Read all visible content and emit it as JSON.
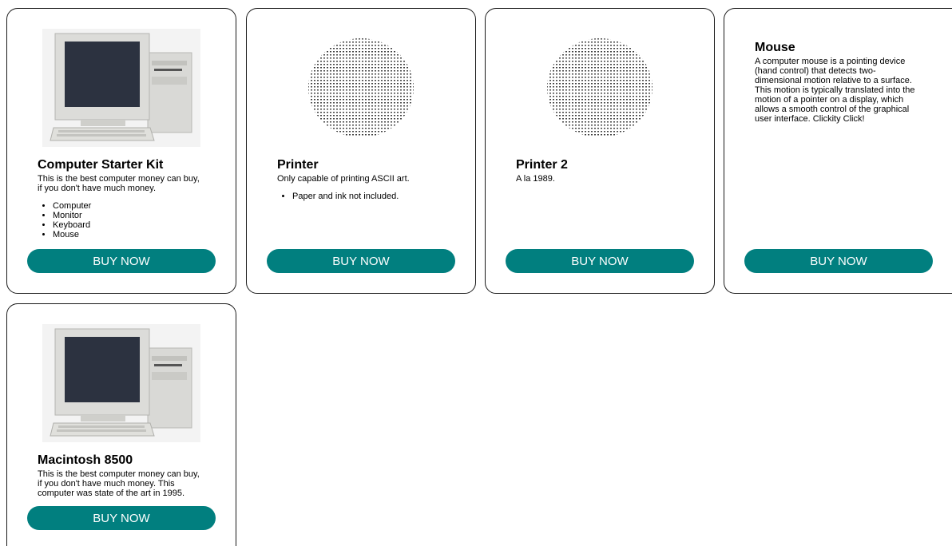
{
  "products": [
    {
      "title": "Computer Starter Kit",
      "description": "This is the best computer money can buy, if you don't have much money.",
      "items": [
        "Computer",
        "Monitor",
        "Keyboard",
        "Mouse"
      ],
      "button": "Buy Now"
    },
    {
      "title": "Printer",
      "description": "Only capable of printing ASCII art.",
      "items": [
        "Paper and ink not included."
      ],
      "button": "Buy Now"
    },
    {
      "title": "Printer 2",
      "description": "A la 1989.",
      "button": "Buy Now"
    },
    {
      "title": "Mouse",
      "description": "A computer mouse is a pointing device (hand control) that detects two-dimensional motion relative to a surface. This motion is typically translated into the motion of a pointer on a display, which allows a smooth control of the graphical user interface. Clickity Click!",
      "button": "Buy Now"
    },
    {
      "title": "Macintosh 8500",
      "description": "This is the best computer money can buy, if you don't have much money. This computer was state of the art in 1995.",
      "button": "Buy Now"
    }
  ],
  "colors": {
    "button_bg": "#017f7f",
    "button_text": "#ffffff",
    "card_border": "#1a1a1a"
  },
  "icons": {
    "computer": "desktop-computer-image",
    "printer": "ascii-printer-art"
  }
}
